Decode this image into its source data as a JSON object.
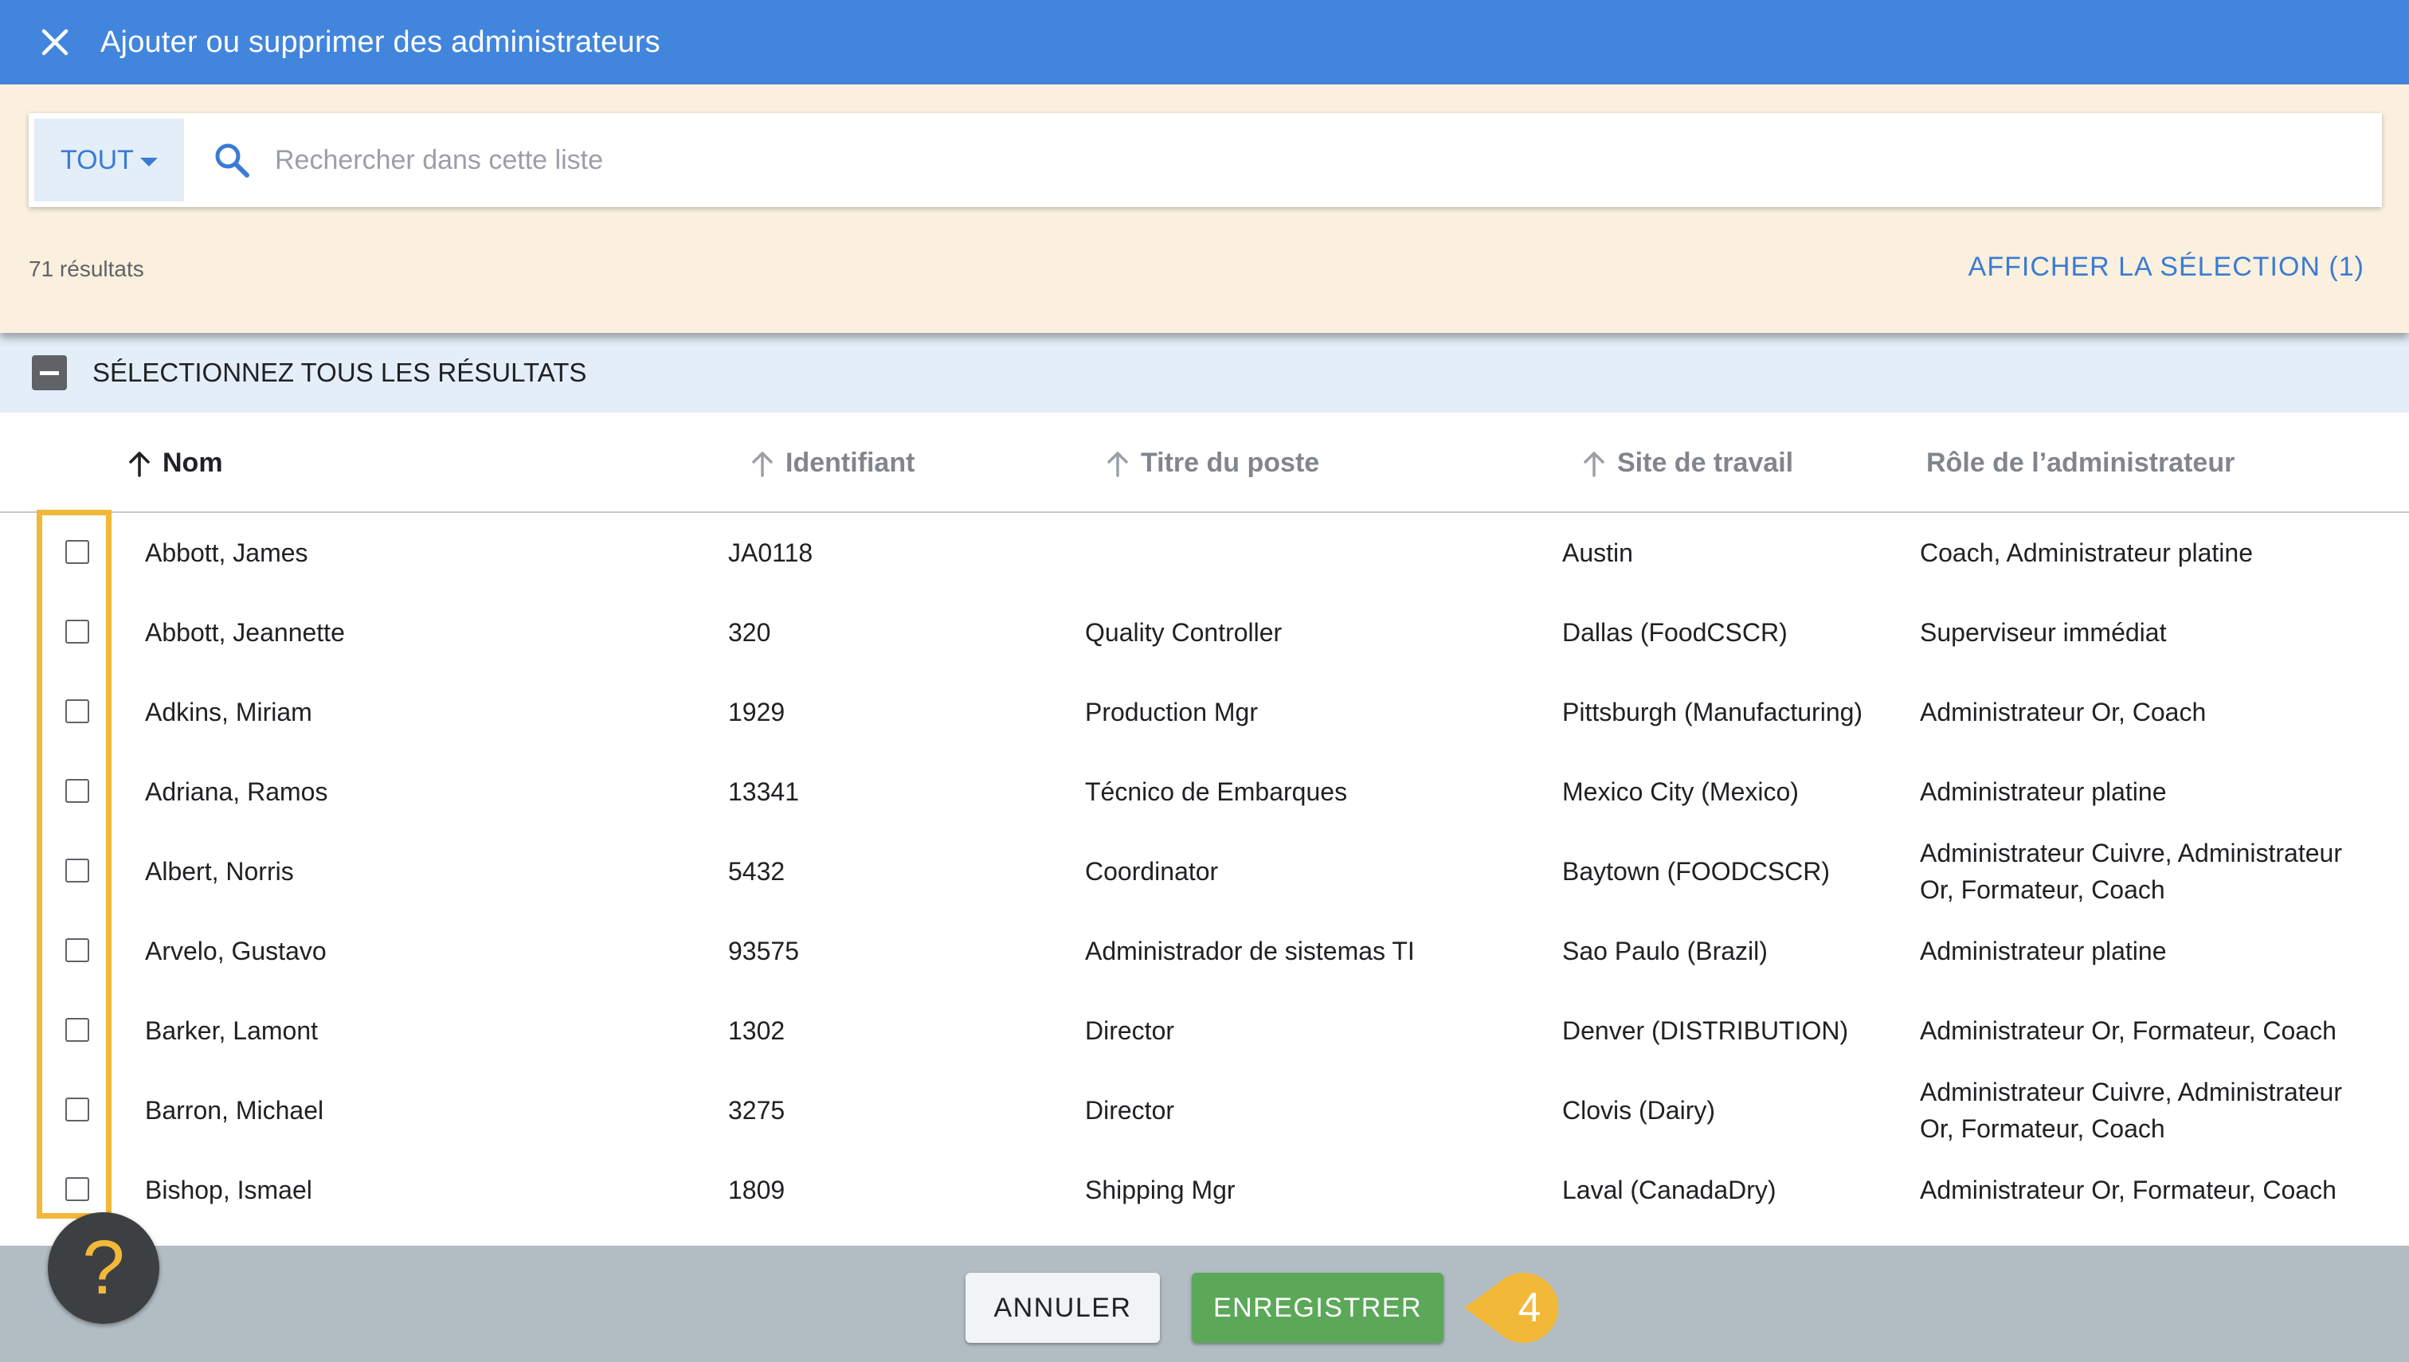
{
  "dialog": {
    "title": "Ajouter ou supprimer des administrateurs"
  },
  "search": {
    "scope_label": "TOUT",
    "placeholder": "Rechercher dans cette liste",
    "value": ""
  },
  "results": {
    "count_text": "71 résultats",
    "show_selection_label": "AFFICHER LA SÉLECTION (1)",
    "select_all_label": "SÉLECTIONNEZ TOUS LES RÉSULTATS"
  },
  "columns": {
    "name": "Nom",
    "id": "Identifiant",
    "job_title": "Titre du poste",
    "work_site": "Site de travail",
    "admin_role": "Rôle de l’administrateur"
  },
  "rows": [
    {
      "name": "Abbott, James",
      "id": "JA0118",
      "job_title": "",
      "site": "Austin",
      "role": "Coach, Administrateur platine",
      "checked": false
    },
    {
      "name": "Abbott, Jeannette",
      "id": "320",
      "job_title": "Quality Controller",
      "site": "Dallas (FoodCSCR)",
      "role": "Superviseur immédiat",
      "checked": false
    },
    {
      "name": "Adkins, Miriam",
      "id": "1929",
      "job_title": "Production Mgr",
      "site": "Pittsburgh (Manufacturing)",
      "role": "Administrateur Or, Coach",
      "checked": false
    },
    {
      "name": "Adriana, Ramos",
      "id": "13341",
      "job_title": "Técnico de Embarques",
      "site": "Mexico City (Mexico)",
      "role": "Administrateur platine",
      "checked": false
    },
    {
      "name": "Albert, Norris",
      "id": "5432",
      "job_title": "Coordinator",
      "site": "Baytown (FOODCSCR)",
      "role": "Administrateur Cuivre, Administrateur Or, Formateur, Coach",
      "checked": false
    },
    {
      "name": "Arvelo, Gustavo",
      "id": "93575",
      "job_title": "Administrador de sistemas TI",
      "site": "Sao Paulo (Brazil)",
      "role": "Administrateur platine",
      "checked": false
    },
    {
      "name": "Barker, Lamont",
      "id": "1302",
      "job_title": "Director",
      "site": "Denver (DISTRIBUTION)",
      "role": "Administrateur Or, Formateur, Coach",
      "checked": false
    },
    {
      "name": "Barron, Michael",
      "id": "3275",
      "job_title": "Director",
      "site": "Clovis (Dairy)",
      "role": "Administrateur Cuivre, Administrateur Or, Formateur, Coach",
      "checked": false
    },
    {
      "name": "Bishop, Ismael",
      "id": "1809",
      "job_title": "Shipping Mgr",
      "site": "Laval (CanadaDry)",
      "role": "Administrateur Or, Formateur, Coach",
      "checked": false
    }
  ],
  "footer": {
    "cancel_label": "ANNULER",
    "save_label": "ENREGISTRER",
    "step_number": "4"
  },
  "help": {
    "icon": "?"
  },
  "colors": {
    "header": "#4285dd",
    "accent": "#3b7bd4",
    "panel": "#fbf0de",
    "select_bar": "#e3eef9",
    "save": "#5ba859",
    "highlight": "#f2b838"
  }
}
